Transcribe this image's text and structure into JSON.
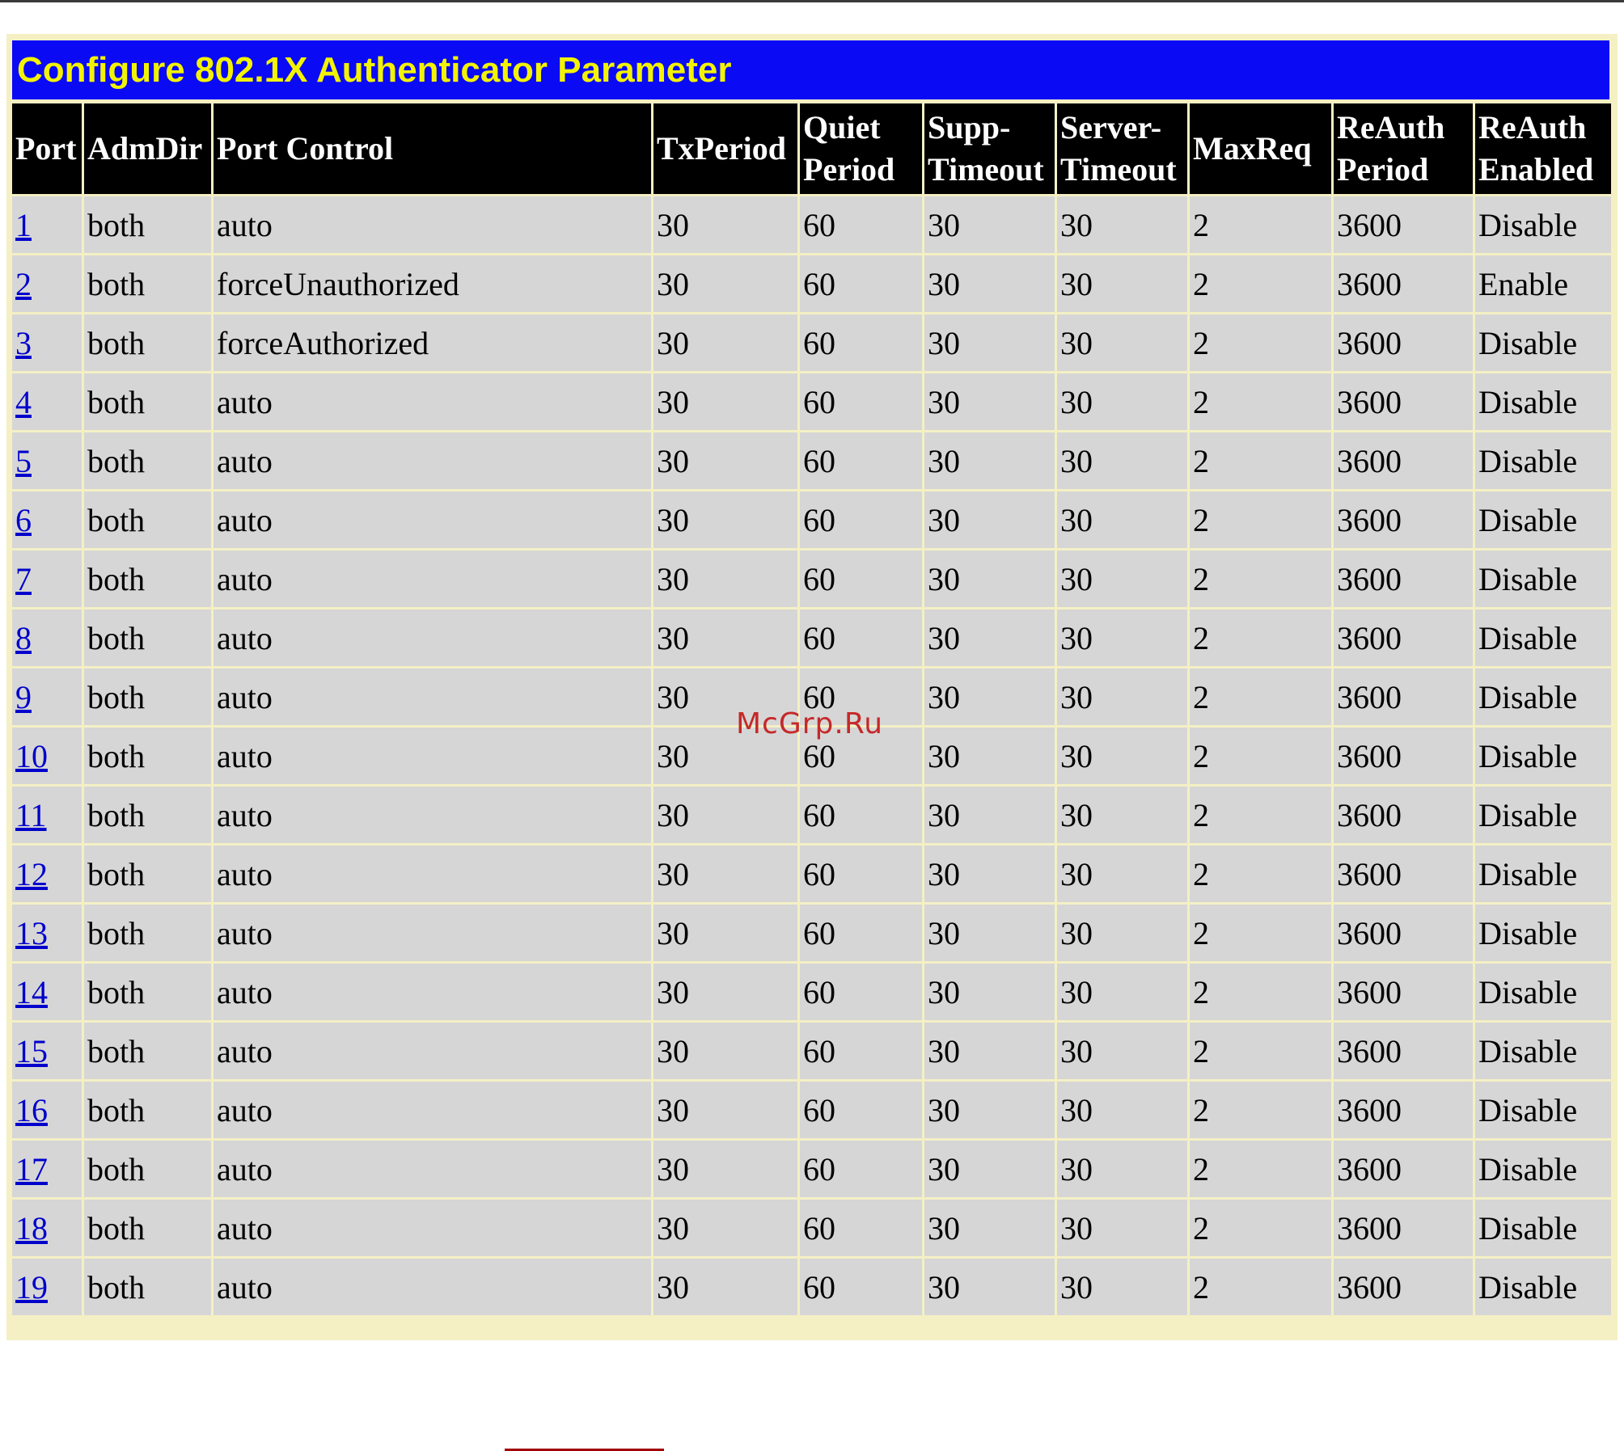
{
  "page_title": "Configure 802.1X Authenticator Parameter",
  "watermark": "McGrp.Ru",
  "colors": {
    "title_bar_bg": "#0a0af5",
    "title_text": "#f2f205",
    "header_bg": "#000000",
    "row_bg": "#d6d6d6",
    "link": "#0000cc"
  },
  "table": {
    "headers": {
      "port": "Port",
      "admdir": "AdmDir",
      "port_control": "Port Control",
      "txperiod": "TxPeriod",
      "quiet_1": "Quiet",
      "quiet_2": "Period",
      "supp_1": "Supp-",
      "supp_2": "Timeout",
      "server_1": "Server-",
      "server_2": "Timeout",
      "maxreq": "MaxReq",
      "reauth_period_1": "ReAuth",
      "reauth_period_2": "Period",
      "reauth_enabled_1": "ReAuth",
      "reauth_enabled_2": "Enabled"
    },
    "rows": [
      {
        "port": "1",
        "admdir": "both",
        "port_control": "auto",
        "txperiod": "30",
        "quiet_period": "60",
        "supp_timeout": "30",
        "server_timeout": "30",
        "maxreq": "2",
        "reauth_period": "3600",
        "reauth_enabled": "Disable"
      },
      {
        "port": "2",
        "admdir": "both",
        "port_control": "forceUnauthorized",
        "txperiod": "30",
        "quiet_period": "60",
        "supp_timeout": "30",
        "server_timeout": "30",
        "maxreq": "2",
        "reauth_period": "3600",
        "reauth_enabled": "Enable"
      },
      {
        "port": "3",
        "admdir": "both",
        "port_control": "forceAuthorized",
        "txperiod": "30",
        "quiet_period": "60",
        "supp_timeout": "30",
        "server_timeout": "30",
        "maxreq": "2",
        "reauth_period": "3600",
        "reauth_enabled": "Disable"
      },
      {
        "port": "4",
        "admdir": "both",
        "port_control": "auto",
        "txperiod": "30",
        "quiet_period": "60",
        "supp_timeout": "30",
        "server_timeout": "30",
        "maxreq": "2",
        "reauth_period": "3600",
        "reauth_enabled": "Disable"
      },
      {
        "port": "5",
        "admdir": "both",
        "port_control": "auto",
        "txperiod": "30",
        "quiet_period": "60",
        "supp_timeout": "30",
        "server_timeout": "30",
        "maxreq": "2",
        "reauth_period": "3600",
        "reauth_enabled": "Disable"
      },
      {
        "port": "6",
        "admdir": "both",
        "port_control": "auto",
        "txperiod": "30",
        "quiet_period": "60",
        "supp_timeout": "30",
        "server_timeout": "30",
        "maxreq": "2",
        "reauth_period": "3600",
        "reauth_enabled": "Disable"
      },
      {
        "port": "7",
        "admdir": "both",
        "port_control": "auto",
        "txperiod": "30",
        "quiet_period": "60",
        "supp_timeout": "30",
        "server_timeout": "30",
        "maxreq": "2",
        "reauth_period": "3600",
        "reauth_enabled": "Disable"
      },
      {
        "port": "8",
        "admdir": "both",
        "port_control": "auto",
        "txperiod": "30",
        "quiet_period": "60",
        "supp_timeout": "30",
        "server_timeout": "30",
        "maxreq": "2",
        "reauth_period": "3600",
        "reauth_enabled": "Disable"
      },
      {
        "port": "9",
        "admdir": "both",
        "port_control": "auto",
        "txperiod": "30",
        "quiet_period": "60",
        "supp_timeout": "30",
        "server_timeout": "30",
        "maxreq": "2",
        "reauth_period": "3600",
        "reauth_enabled": "Disable"
      },
      {
        "port": "10",
        "admdir": "both",
        "port_control": "auto",
        "txperiod": "30",
        "quiet_period": "60",
        "supp_timeout": "30",
        "server_timeout": "30",
        "maxreq": "2",
        "reauth_period": "3600",
        "reauth_enabled": "Disable"
      },
      {
        "port": "11",
        "admdir": "both",
        "port_control": "auto",
        "txperiod": "30",
        "quiet_period": "60",
        "supp_timeout": "30",
        "server_timeout": "30",
        "maxreq": "2",
        "reauth_period": "3600",
        "reauth_enabled": "Disable"
      },
      {
        "port": "12",
        "admdir": "both",
        "port_control": "auto",
        "txperiod": "30",
        "quiet_period": "60",
        "supp_timeout": "30",
        "server_timeout": "30",
        "maxreq": "2",
        "reauth_period": "3600",
        "reauth_enabled": "Disable"
      },
      {
        "port": "13",
        "admdir": "both",
        "port_control": "auto",
        "txperiod": "30",
        "quiet_period": "60",
        "supp_timeout": "30",
        "server_timeout": "30",
        "maxreq": "2",
        "reauth_period": "3600",
        "reauth_enabled": "Disable"
      },
      {
        "port": "14",
        "admdir": "both",
        "port_control": "auto",
        "txperiod": "30",
        "quiet_period": "60",
        "supp_timeout": "30",
        "server_timeout": "30",
        "maxreq": "2",
        "reauth_period": "3600",
        "reauth_enabled": "Disable"
      },
      {
        "port": "15",
        "admdir": "both",
        "port_control": "auto",
        "txperiod": "30",
        "quiet_period": "60",
        "supp_timeout": "30",
        "server_timeout": "30",
        "maxreq": "2",
        "reauth_period": "3600",
        "reauth_enabled": "Disable"
      },
      {
        "port": "16",
        "admdir": "both",
        "port_control": "auto",
        "txperiod": "30",
        "quiet_period": "60",
        "supp_timeout": "30",
        "server_timeout": "30",
        "maxreq": "2",
        "reauth_period": "3600",
        "reauth_enabled": "Disable"
      },
      {
        "port": "17",
        "admdir": "both",
        "port_control": "auto",
        "txperiod": "30",
        "quiet_period": "60",
        "supp_timeout": "30",
        "server_timeout": "30",
        "maxreq": "2",
        "reauth_period": "3600",
        "reauth_enabled": "Disable"
      },
      {
        "port": "18",
        "admdir": "both",
        "port_control": "auto",
        "txperiod": "30",
        "quiet_period": "60",
        "supp_timeout": "30",
        "server_timeout": "30",
        "maxreq": "2",
        "reauth_period": "3600",
        "reauth_enabled": "Disable"
      },
      {
        "port": "19",
        "admdir": "both",
        "port_control": "auto",
        "txperiod": "30",
        "quiet_period": "60",
        "supp_timeout": "30",
        "server_timeout": "30",
        "maxreq": "2",
        "reauth_period": "3600",
        "reauth_enabled": "Disable"
      }
    ]
  }
}
